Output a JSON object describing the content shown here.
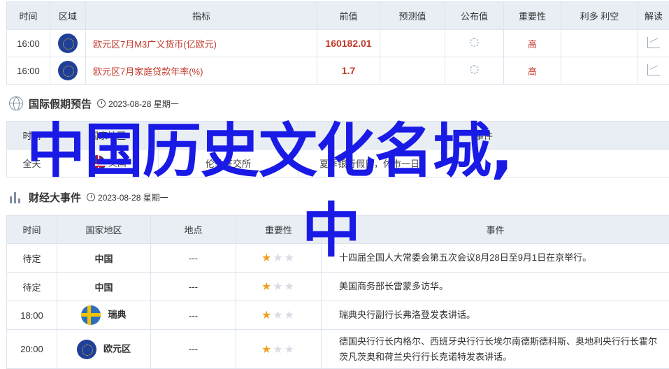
{
  "econ": {
    "headers": [
      "时间",
      "区域",
      "指标",
      "前值",
      "预测值",
      "公布值",
      "重要性",
      "利多 利空",
      "解读"
    ],
    "rows": [
      {
        "time": "16:00",
        "region_flag": "eu",
        "indicator": "欧元区7月M3广义货币(亿欧元)",
        "previous": "160182.01",
        "importance": "高"
      },
      {
        "time": "16:00",
        "region_flag": "eu",
        "indicator": "欧元区7月家庭贷款年率(%)",
        "previous": "1.7",
        "importance": "高"
      }
    ]
  },
  "holidays": {
    "title": "国际假期预告",
    "date": "2023-08-28 星期一",
    "headers": [
      "时间",
      "国家地区",
      "",
      "事件"
    ],
    "row": {
      "time": "全天",
      "country": "英国",
      "desc_a": "伦敦证交所",
      "desc_b": "夏季银行假日，休市一日。"
    }
  },
  "events": {
    "title": "财经大事件",
    "date": "2023-08-28 星期一",
    "headers": [
      "时间",
      "国家地区",
      "地点",
      "重要性",
      "事件"
    ],
    "rows": [
      {
        "time": "待定",
        "country": "中国",
        "flag": "",
        "place": "---",
        "stars": 1,
        "text": "十四届全国人大常委会第五次会议8月28日至9月1日在京举行。"
      },
      {
        "time": "待定",
        "country": "中国",
        "flag": "",
        "place": "---",
        "stars": 1,
        "text": "美国商务部长雷蒙多访华。"
      },
      {
        "time": "18:00",
        "country": "瑞典",
        "flag": "se",
        "place": "---",
        "stars": 1,
        "text": "瑞典央行副行长弗洛登发表讲话。"
      },
      {
        "time": "20:00",
        "country": "欧元区",
        "flag": "eu",
        "place": "---",
        "stars": 1,
        "text": "德国央行行长内格尔、西班牙央行行长埃尔南德斯德科斯、奥地利央行行长霍尔茨凡茨奥和荷兰央行行长克诺特发表讲话。"
      }
    ]
  },
  "overlay": {
    "line1": "中国历史文化名城,",
    "line2": "中"
  },
  "colors": {
    "accent_red": "#c0392b",
    "overlay_blue": "#1a1ae6",
    "header_bg": "#e9eef5",
    "star_on": "#f0a020"
  }
}
